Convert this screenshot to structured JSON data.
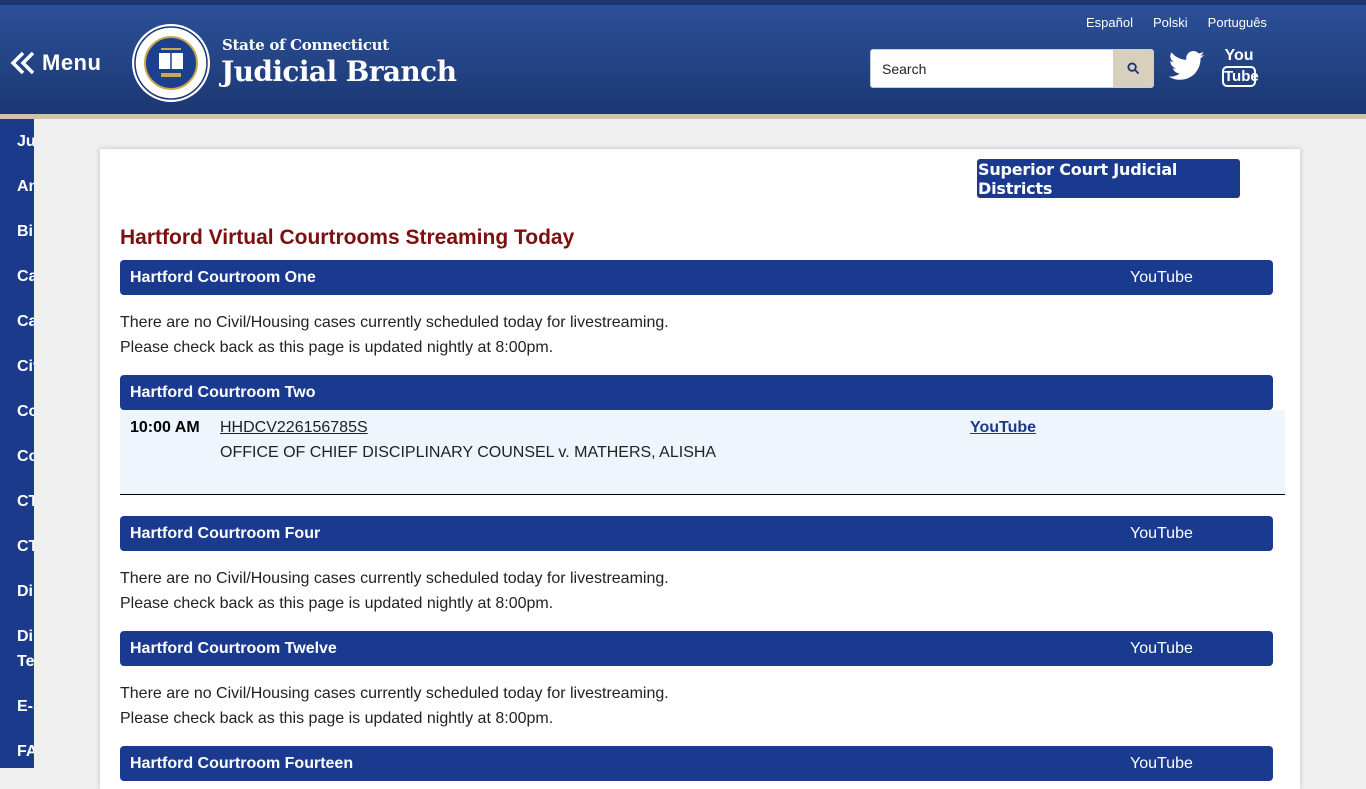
{
  "header": {
    "menu_label": "Menu",
    "brand_small": "State of Connecticut",
    "brand_big": "Judicial Branch",
    "languages": [
      "Español",
      "Polski",
      "Português"
    ],
    "search_placeholder": "Search",
    "social": {
      "youtube_top": "You",
      "youtube_bottom": "Tube"
    }
  },
  "sidebar": {
    "items": [
      "Jud",
      "An",
      "Bi",
      "Ca",
      "Ca",
      "Civ",
      "Co",
      "Co",
      "CT",
      "CT",
      "Di",
      "Di",
      "Te",
      "E-S",
      "FA"
    ]
  },
  "main": {
    "districts_button": "Superior Court Judicial Districts",
    "title": "Hartford Virtual Courtrooms Streaming Today",
    "youtube_label": "YouTube",
    "no_cases_line1": "There are no Civil/Housing cases currently scheduled today for livestreaming.",
    "no_cases_line2": "Please check back as this page is updated nightly at 8:00pm.",
    "rooms": [
      {
        "name": "Hartford Courtroom One"
      },
      {
        "name": "Hartford Courtroom Two"
      },
      {
        "name": "Hartford Courtroom Four"
      },
      {
        "name": "Hartford Courtroom Twelve"
      },
      {
        "name": "Hartford Courtroom Fourteen"
      }
    ],
    "case": {
      "time": "10:00 AM",
      "number": "HHDCV226156785S",
      "title": "OFFICE OF CHIEF DISCIPLINARY COUNSEL v. MATHERS, ALISHA",
      "link": "YouTube"
    }
  },
  "colors": {
    "header_blue": "#234384",
    "bar_blue": "#193a8f",
    "title_red": "#7d0f0f",
    "case_bg": "#eef5fd"
  }
}
